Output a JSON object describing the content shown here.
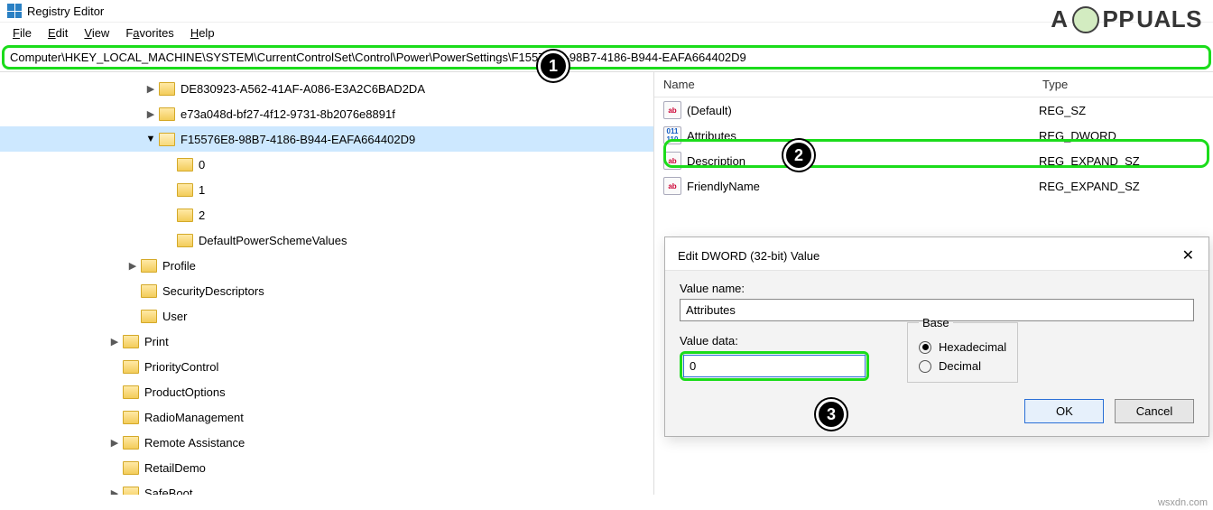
{
  "window": {
    "title": "Registry Editor"
  },
  "menu": {
    "file": "File",
    "edit": "Edit",
    "view": "View",
    "favorites": "Favorites",
    "help": "Help"
  },
  "address": "Computer\\HKEY_LOCAL_MACHINE\\SYSTEM\\CurrentControlSet\\Control\\Power\\PowerSettings\\F15576E8-98B7-4186-B944-EAFA664402D9",
  "tree": {
    "siblings_above": [
      "DE830923-A562-41AF-A086-E3A2C6BAD2DA",
      "e73a048d-bf27-4f12-9731-8b2076e8891f"
    ],
    "selected": "F15576E8-98B7-4186-B944-EAFA664402D9",
    "children": [
      "0",
      "1",
      "2",
      "DefaultPowerSchemeValues"
    ],
    "after": [
      "Profile",
      "SecurityDescriptors",
      "User"
    ],
    "power_siblings": [
      "Print",
      "PriorityControl",
      "ProductOptions",
      "RadioManagement",
      "Remote Assistance",
      "RetailDemo",
      "SafeBoot"
    ]
  },
  "list": {
    "headers": {
      "name": "Name",
      "type": "Type"
    },
    "rows": [
      {
        "name": "(Default)",
        "type": "REG_SZ",
        "kind": "sz"
      },
      {
        "name": "Attributes",
        "type": "REG_DWORD",
        "kind": "dword"
      },
      {
        "name": "Description",
        "type": "REG_EXPAND_SZ",
        "kind": "sz"
      },
      {
        "name": "FriendlyName",
        "type": "REG_EXPAND_SZ",
        "kind": "sz"
      }
    ]
  },
  "dialog": {
    "title": "Edit DWORD (32-bit) Value",
    "value_name_label": "Value name:",
    "value_name": "Attributes",
    "value_data_label": "Value data:",
    "value_data": "0",
    "base_label": "Base",
    "hex": "Hexadecimal",
    "dec": "Decimal",
    "ok": "OK",
    "cancel": "Cancel"
  },
  "annotations": {
    "one": "1",
    "two": "2",
    "three": "3"
  },
  "brand": {
    "a1": "A",
    "pp": "PP",
    "uals": "UALS"
  },
  "watermark": "wsxdn.com"
}
